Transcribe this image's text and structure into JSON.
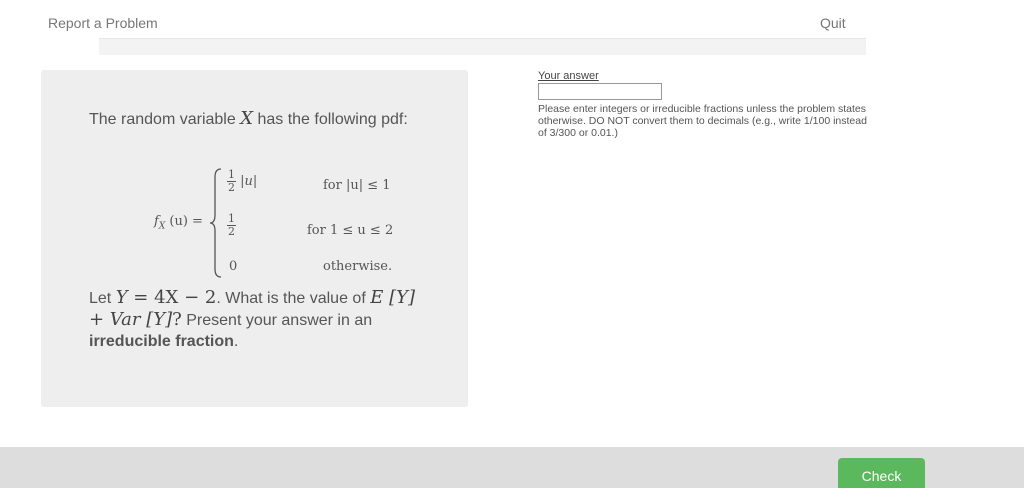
{
  "header": {
    "report_label": "Report a Problem",
    "quit_label": "Quit"
  },
  "progress": {
    "fraction": 0
  },
  "question": {
    "intro_before": "The random variable ",
    "intro_var": "X",
    "intro_after": " has the following pdf:",
    "pdf": {
      "lhs": "f",
      "lhs_sub": "X",
      "lhs_arg": "(u) =",
      "rows": [
        {
          "num": "1",
          "den": "2",
          "expr": "|u|",
          "cond": "for |u| ≤ 1"
        },
        {
          "num": "1",
          "den": "2",
          "cond": "for 1 ≤ u ≤ 2"
        },
        {
          "value": "0",
          "cond": "otherwise."
        }
      ]
    },
    "let": "Let ",
    "eq_y": "Y",
    "eq_rhs": " = 4X − 2",
    "what": ". What is the value of",
    "exp": "E [Y] + Var [Y]",
    "q": "?",
    "present": " Present your answer in an ",
    "bold": "irreducible fraction",
    "period": "."
  },
  "answer": {
    "label": "Your answer",
    "value": "",
    "help": "Please enter integers or irreducible fractions unless the problem states otherwise. DO NOT convert them to decimals (e.g., write 1/100 instead of 3/300 or 0.01.)"
  },
  "footer": {
    "check_label": "Check"
  },
  "colors": {
    "check": "#5cb85c",
    "card": "#eeeeee",
    "bar": "#dddddd"
  }
}
